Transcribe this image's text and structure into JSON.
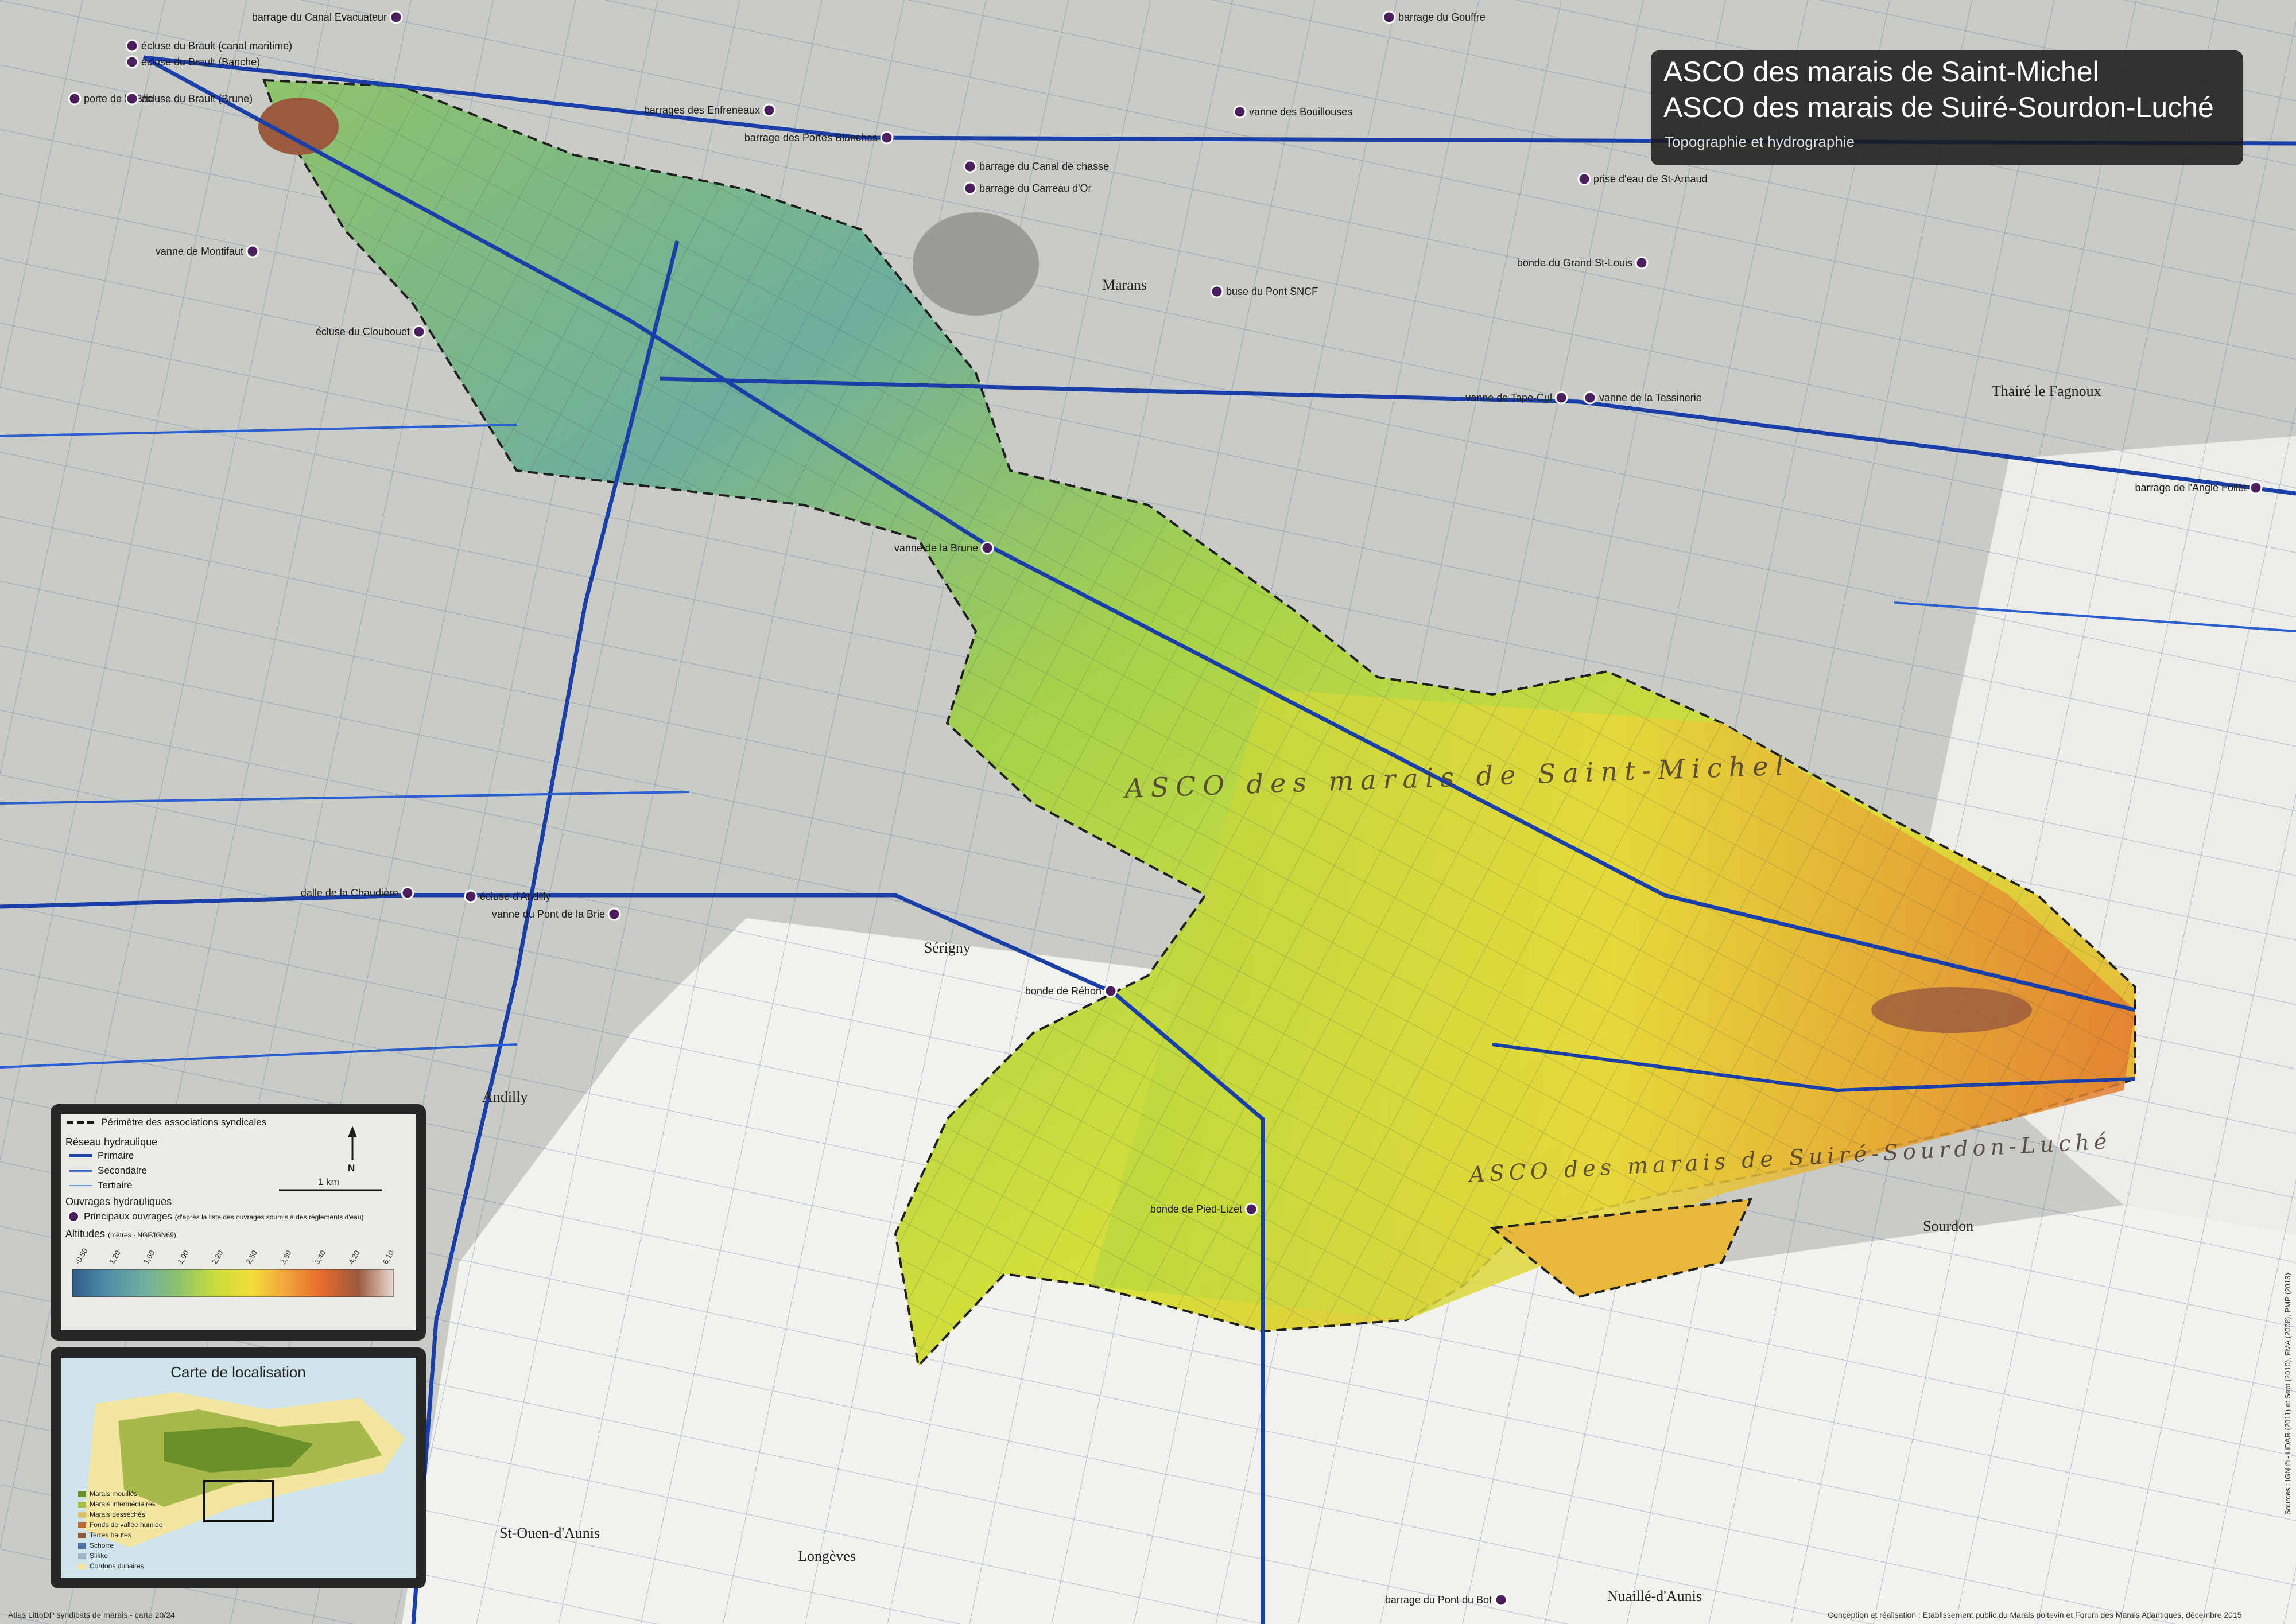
{
  "title": {
    "line1": "ASCO des marais de Saint-Michel",
    "line2": "ASCO des marais de Suiré-Sourdon-Luché",
    "subtitle": "Topographie et hydrographie"
  },
  "map_labels": {
    "asco_saint_michel": "ASCO des marais de Saint-Michel",
    "asco_suire": "ASCO des marais de Suiré-Sourdon-Luché",
    "towns": [
      "Marans",
      "Andilly",
      "St-Ouen-d'Aunis",
      "Longèves",
      "Nuaillé-d'Aunis",
      "Sourdon",
      "Thairé le Fagnoux",
      "Sérigny"
    ]
  },
  "structures": [
    "barrage du Canal Evacuateur",
    "barrage du Gouffre",
    "écluse du Brault (canal maritime)",
    "écluse du Brault (Banche)",
    "porte de la Brie",
    "écluse du Brault (Brune)",
    "barrages des Enfreneaux",
    "barrage des Portes Blanches",
    "vanne des Bouillouses",
    "barrage du Canal de chasse",
    "barrage du Carreau d'Or",
    "prise d'eau de St-Arnaud",
    "vanne de Montifaut",
    "buse du Pont SNCF",
    "bonde du Grand St-Louis",
    "écluse du Cloubouet",
    "vanne de Tape-Cul",
    "vanne de la Tessinerie",
    "barrage de l'Angle Follet",
    "vanne de la Brune",
    "dalle de la Chaudière",
    "écluse d'Andilly",
    "vanne du Pont de la Brie",
    "bonde de Réhon",
    "bonde de Pied-Lizet",
    "barrage du Pont du Bot"
  ],
  "legend": {
    "perimeter": "Périmètre des associations syndicales",
    "network_header": "Réseau hydraulique",
    "primary": "Primaire",
    "secondary": "Secondaire",
    "tertiary": "Tertiaire",
    "works_header": "Ouvrages hydrauliques",
    "main_works": "Principaux ouvrages",
    "main_works_note": "(d'après la liste des ouvrages soumis à des règlements d'eau)",
    "altitudes_header": "Altitudes",
    "altitudes_unit": "(mètres - NGF/IGN69)",
    "north": "N",
    "scale": "1 km",
    "ticks": [
      "-0,50",
      "1,20",
      "1,60",
      "1,90",
      "2,20",
      "2,50",
      "2,80",
      "3,40",
      "4,20",
      "6,10"
    ],
    "colors": [
      "#2f5d8a",
      "#4f8fa8",
      "#6fae9e",
      "#8fc46a",
      "#c8dc3a",
      "#f2de3a",
      "#f3a33a",
      "#e56a2c",
      "#9a5a3e",
      "#eadbd3"
    ]
  },
  "location_map": {
    "title": "Carte de localisation",
    "items": [
      {
        "label": "Marais mouillés",
        "color": "#6a8f2b"
      },
      {
        "label": "Marais intermédiaires",
        "color": "#a6b94a"
      },
      {
        "label": "Marais desséchés",
        "color": "#d9c26a"
      },
      {
        "label": "Fonds de vallée humide",
        "color": "#b86a3a"
      },
      {
        "label": "Terres hautes",
        "color": "#8a5a3a"
      },
      {
        "label": "Schorre",
        "color": "#4a6fa0"
      },
      {
        "label": "Slikke",
        "color": "#9fb7c8"
      },
      {
        "label": "Cordons dunaires",
        "color": "#f3e6a0"
      }
    ]
  },
  "footer": {
    "left": "Atlas LittoDP syndicats de marais - carte 20/24",
    "right": "Conception et réalisation : Etablissement public du Marais poitevin et Forum des Marais Atlantiques, décembre 2015",
    "credits": "Sources : IGN © - LiDAR (2011) et Sept (2010), FMA (2008), PMP (2013)"
  }
}
